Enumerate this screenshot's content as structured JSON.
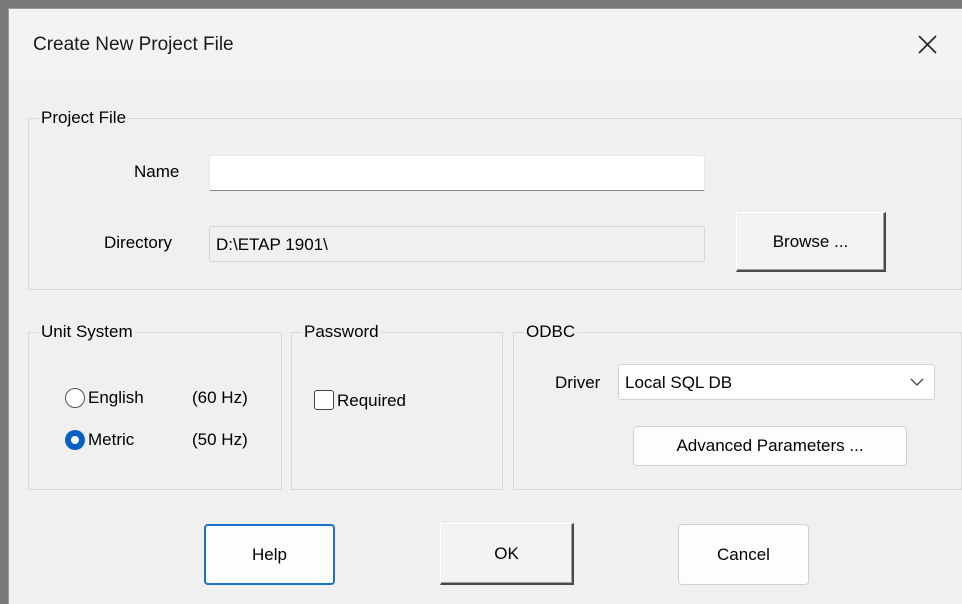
{
  "dialog": {
    "title": "Create New Project File",
    "close_icon": "close-icon"
  },
  "project_file": {
    "legend": "Project File",
    "name_label": "Name",
    "name_value": "",
    "directory_label": "Directory",
    "directory_value": "D:\\ETAP 1901\\",
    "browse_label": "Browse ..."
  },
  "unit_system": {
    "legend": "Unit System",
    "options": [
      {
        "label": "English",
        "freq": "(60 Hz)",
        "checked": false
      },
      {
        "label": "Metric",
        "freq": "(50 Hz)",
        "checked": true
      }
    ]
  },
  "password": {
    "legend": "Password",
    "required_label": "Required",
    "required_checked": false
  },
  "odbc": {
    "legend": "ODBC",
    "driver_label": "Driver",
    "driver_value": "Local SQL DB",
    "advanced_label": "Advanced Parameters ..."
  },
  "buttons": {
    "help": "Help",
    "ok": "OK",
    "cancel": "Cancel"
  },
  "colors": {
    "accent": "#0a5fc2",
    "focus": "#1a73c8"
  }
}
